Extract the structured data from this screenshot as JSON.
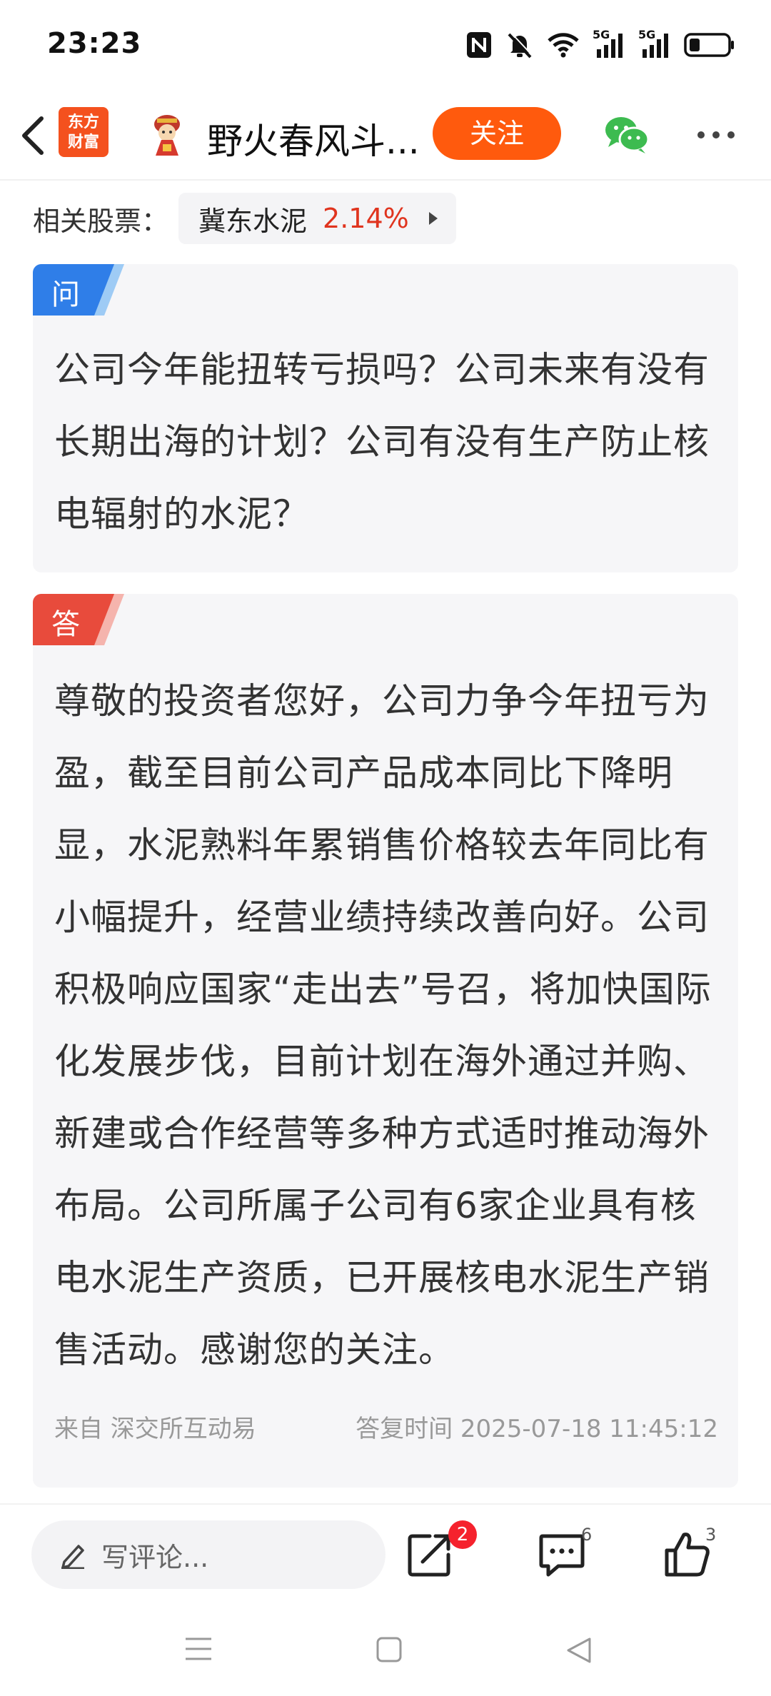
{
  "status_bar": {
    "time": "23:23",
    "network_1": "5G",
    "network_2": "5G",
    "icons": [
      "nfc-icon",
      "bell-muted-icon",
      "wifi-icon",
      "signal-5g-icon",
      "signal-5g-icon",
      "battery-icon"
    ]
  },
  "nav": {
    "logo_line1": "东方",
    "logo_line2": "财富",
    "title": "野火春风斗...",
    "follow_label": "关注",
    "icons": [
      "back-icon",
      "avatar",
      "wechat-icon",
      "more-icon"
    ]
  },
  "related": {
    "label": "相关股票：",
    "stock_name": "冀东水泥",
    "stock_change": "2.14%",
    "change_color": "#e0341e"
  },
  "question": {
    "tag": "问",
    "tag_color": "#2f7ee8",
    "text": "公司今年能扭转亏损吗？公司未来有没有长期出海的计划？公司有没有生产防止核电辐射的水泥？"
  },
  "answer": {
    "tag": "答",
    "tag_color": "#e84b3c",
    "text": "尊敬的投资者您好，公司力争今年扭亏为盈，截至目前公司产品成本同比下降明显，水泥熟料年累销售价格较去年同比有小幅提升，经营业绩持续改善向好。公司积极响应国家“走出去”号召，将加快国际化发展步伐，目前计划在海外通过并购、新建或合作经营等多种方式适时推动海外布局。公司所属子公司有6家企业具有核电水泥生产资质，已开展核电水泥生产销售活动。感谢您的关注。",
    "source": "来自 深交所互动易",
    "reply_time": "答复时间 2025-07-18 11:45:12"
  },
  "actions": {
    "comment_placeholder": "写评论...",
    "share_badge": "2",
    "comment_count": "6",
    "like_count": "3",
    "accent": "#ff5a0d"
  },
  "system_nav": [
    "menu-icon",
    "home-icon",
    "back-triangle-icon"
  ]
}
